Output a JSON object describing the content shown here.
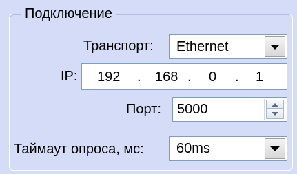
{
  "group": {
    "title": "Подключение"
  },
  "transport": {
    "label": "Транспорт:",
    "value": "Ethernet"
  },
  "ip": {
    "label": "IP:",
    "octets": [
      "192",
      "168",
      "0",
      "1"
    ],
    "separator": "."
  },
  "port": {
    "label": "Порт:",
    "value": "5000"
  },
  "timeout": {
    "label": "Таймаут опроса, мс:",
    "value": "60ms"
  },
  "colors": {
    "background": "#d4dcf8",
    "field_border": "#7f9db9",
    "field_bg": "#ffffff"
  },
  "icons": {
    "dropdown": "chevron-down-icon",
    "spinner_up": "spin-up-icon",
    "spinner_down": "spin-down-icon"
  }
}
